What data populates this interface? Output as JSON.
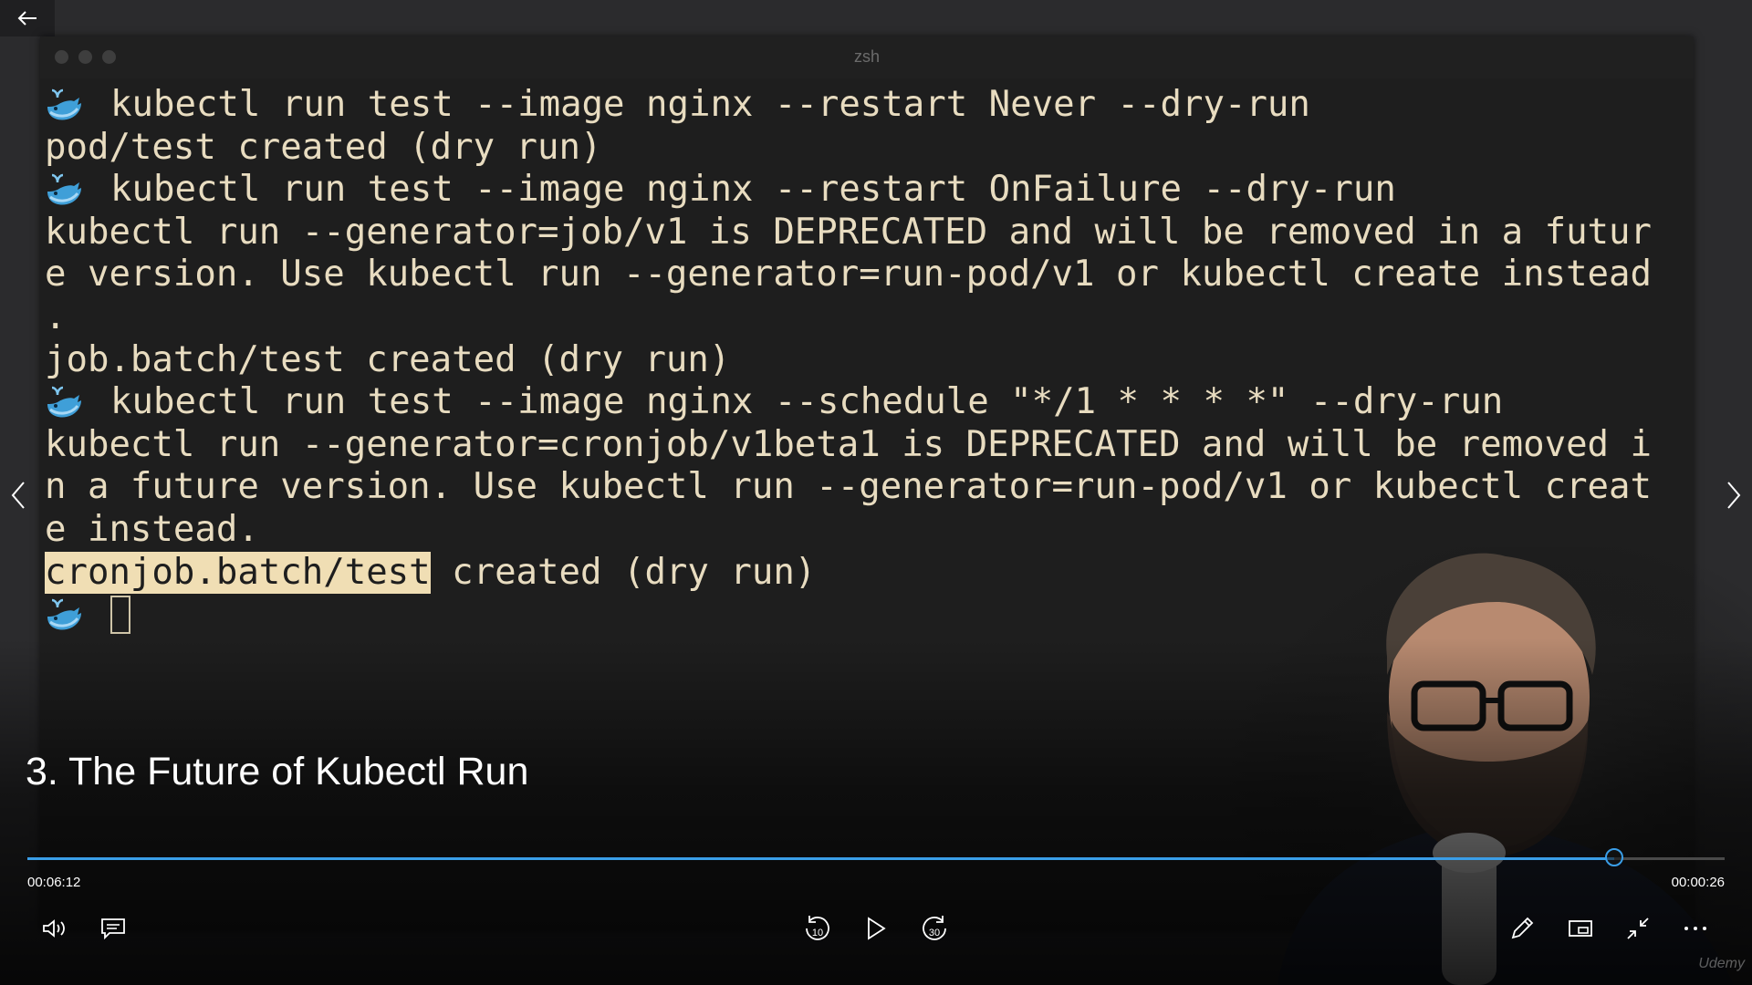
{
  "terminal": {
    "title": "zsh",
    "lines": [
      {
        "prompt": true,
        "text": "kubectl run test --image nginx --restart Never --dry-run"
      },
      {
        "prompt": false,
        "text": "pod/test created (dry run)"
      },
      {
        "prompt": true,
        "text": "kubectl run test --image nginx --restart OnFailure --dry-run"
      },
      {
        "prompt": false,
        "text": "kubectl run --generator=job/v1 is DEPRECATED and will be removed in a futur"
      },
      {
        "prompt": false,
        "text": "e version. Use kubectl run --generator=run-pod/v1 or kubectl create instead"
      },
      {
        "prompt": false,
        "text": "."
      },
      {
        "prompt": false,
        "text": "job.batch/test created (dry run)"
      },
      {
        "prompt": true,
        "text": "kubectl run test --image nginx --schedule \"*/1 * * * *\" --dry-run"
      },
      {
        "prompt": false,
        "text": "kubectl run --generator=cronjob/v1beta1 is DEPRECATED and will be removed i"
      },
      {
        "prompt": false,
        "text": "n a future version. Use kubectl run --generator=run-pod/v1 or kubectl creat"
      },
      {
        "prompt": false,
        "text": "e instead."
      }
    ],
    "highlight_line": {
      "highlighted": "cronjob.batch/test",
      "rest": " created (dry run)"
    },
    "prompt_icon": "whale-icon"
  },
  "video": {
    "title": "3. The Future of Kubectl Run",
    "elapsed": "00:06:12",
    "remaining": "00:00:26",
    "progress": 0.935,
    "accent_color": "#3a9ee8"
  },
  "controls": {
    "left": [
      "volume-icon",
      "captions-icon"
    ],
    "center": [
      {
        "icon": "rewind-icon",
        "label": "10"
      },
      {
        "icon": "play-icon",
        "label": ""
      },
      {
        "icon": "forward-icon",
        "label": "30"
      }
    ],
    "right": [
      "pen-icon",
      "mini-view-icon",
      "exit-fullscreen-icon",
      "more-icon"
    ]
  },
  "watermark": "Udemy"
}
